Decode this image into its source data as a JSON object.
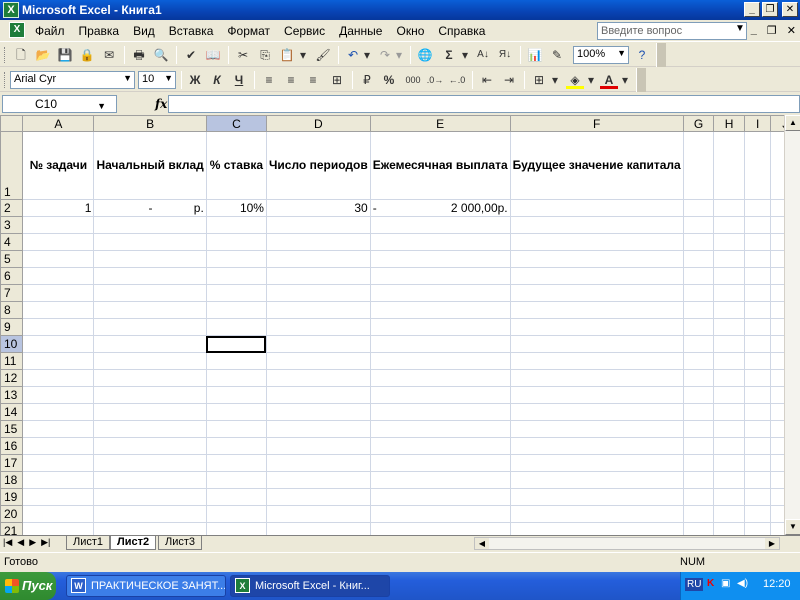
{
  "window": {
    "title": "Microsoft Excel - Книга1"
  },
  "menu": [
    "Файл",
    "Правка",
    "Вид",
    "Вставка",
    "Формат",
    "Сервис",
    "Данные",
    "Окно",
    "Справка"
  ],
  "help_placeholder": "Введите вопрос",
  "toolbar": {
    "zoom": "100%",
    "font": "Arial Cyr",
    "font_size": "10",
    "percent_btn": "%",
    "thousands_btn": "000"
  },
  "formula": {
    "cell_ref": "C10",
    "fx": "fx",
    "value": ""
  },
  "columns": [
    "A",
    "B",
    "C",
    "D",
    "E",
    "F",
    "G",
    "H",
    "I",
    "J"
  ],
  "header_row": [
    "№ задачи",
    "Начальный вклад",
    "% ставка",
    "Число периодов",
    "Ежемесячная выплата",
    "Будущее значение капитала",
    "",
    "",
    "",
    ""
  ],
  "row2": {
    "a": "1",
    "b_dash": "-",
    "b_unit": "р.",
    "c": "10%",
    "d": "30",
    "e_dash": "-",
    "e": "2 000,00р."
  },
  "sheets": [
    "Лист1",
    "Лист2",
    "Лист3"
  ],
  "status": {
    "ready": "Готово",
    "num": "NUM"
  },
  "taskbar": {
    "start": "Пуск",
    "items": [
      "ПРАКТИЧЕСКОЕ ЗАНЯТ...",
      "Microsoft Excel - Книг..."
    ],
    "lang": "RU",
    "clock": "12:20"
  },
  "colors": {
    "title": "#0843b3",
    "grid": "#d0d7e5",
    "selected_col": "#b8c4e0"
  }
}
